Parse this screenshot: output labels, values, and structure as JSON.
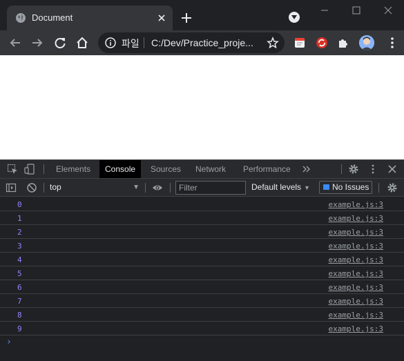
{
  "browser": {
    "tab": {
      "title": "Document"
    },
    "address_bar": {
      "scheme_label": "파일",
      "url": "C:/Dev/Practice_proje..."
    }
  },
  "devtools": {
    "tabs": [
      {
        "label": "Elements"
      },
      {
        "label": "Console",
        "active": true
      },
      {
        "label": "Sources"
      },
      {
        "label": "Network"
      },
      {
        "label": "Performance"
      }
    ],
    "filter_bar": {
      "context": "top",
      "filter_placeholder": "Filter",
      "levels": "Default levels",
      "issues": "No Issues"
    },
    "console_rows": [
      {
        "value": "0",
        "source": "example.js:3"
      },
      {
        "value": "1",
        "source": "example.js:3"
      },
      {
        "value": "2",
        "source": "example.js:3"
      },
      {
        "value": "3",
        "source": "example.js:3"
      },
      {
        "value": "4",
        "source": "example.js:3"
      },
      {
        "value": "5",
        "source": "example.js:3"
      },
      {
        "value": "6",
        "source": "example.js:3"
      },
      {
        "value": "7",
        "source": "example.js:3"
      },
      {
        "value": "8",
        "source": "example.js:3"
      },
      {
        "value": "9",
        "source": "example.js:3"
      }
    ],
    "prompt": "›"
  },
  "colors": {
    "number_value": "#9980ff",
    "prompt": "#4e8ff6",
    "active_tab_bg": "#000000",
    "issues_badge": "#3a8bf7"
  }
}
